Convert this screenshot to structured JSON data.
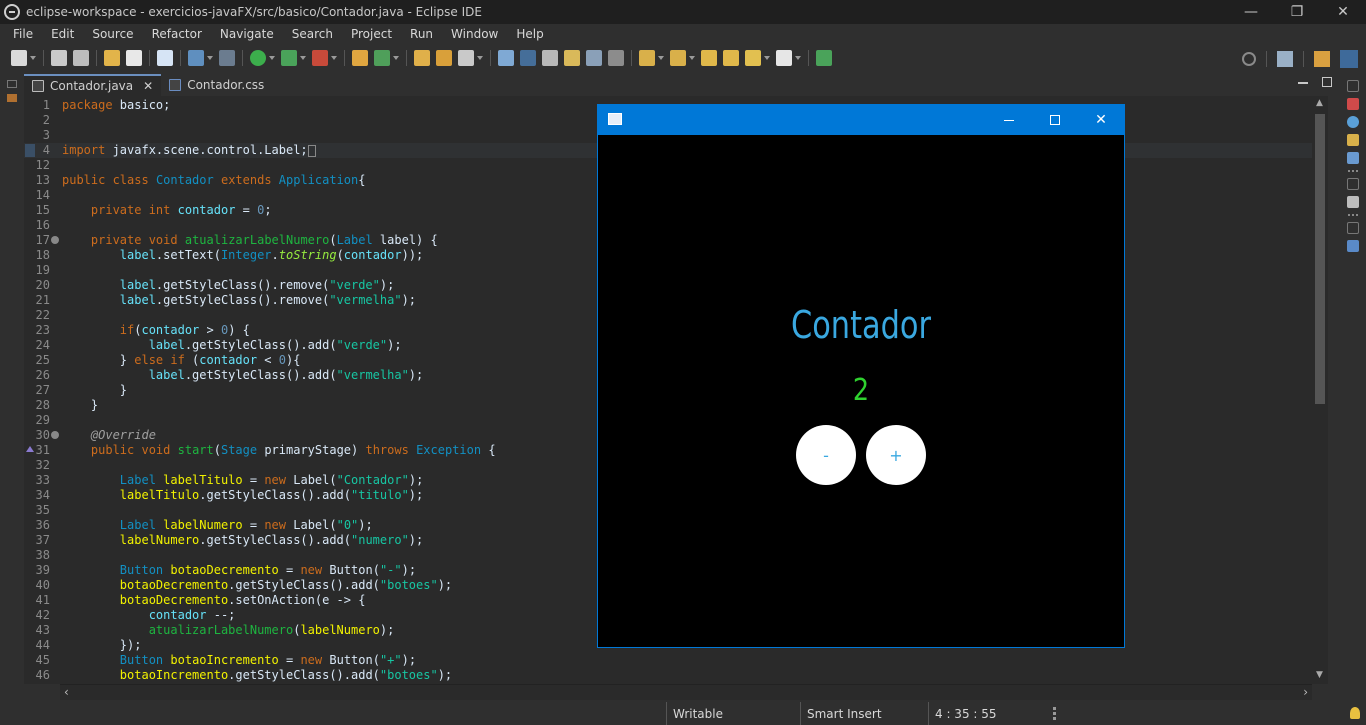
{
  "window": {
    "title": "eclipse-workspace - exercicios-javaFX/src/basico/Contador.java - Eclipse IDE",
    "minimize": "—",
    "restore": "❐",
    "close": "✕"
  },
  "menu": [
    "File",
    "Edit",
    "Source",
    "Refactor",
    "Navigate",
    "Search",
    "Project",
    "Run",
    "Window",
    "Help"
  ],
  "tabs": [
    {
      "label": "Contador.java",
      "close": "✕",
      "active": true
    },
    {
      "label": "Contador.css",
      "active": false
    }
  ],
  "code": {
    "l1_num": "1",
    "l1_kw": "package",
    "l1_txt": " basico;",
    "l2_num": "2",
    "l3_num": "3",
    "l4_num": "4",
    "l4_kw": "import",
    "l4_txt": " javafx.scene.control.Label;",
    "l12_num": "12",
    "l13_num": "13",
    "l13_kw1": "public class",
    "l13_cls": "Contador",
    "l13_kw2": "extends",
    "l13_sup": "Application",
    "l13_end": "{",
    "l14_num": "14",
    "l15_num": "15",
    "l15_kw": "private int",
    "l15_fld": "contador",
    "l15_eq": " = ",
    "l15_val": "0",
    "l15_end": ";",
    "l16_num": "16",
    "l17_num": "17",
    "l17_kw": "private void",
    "l17_m": "atualizarLabelNumero",
    "l17_p1": "(",
    "l17_ty": "Label",
    "l17_p2": " label) {",
    "l18_num": "18",
    "l18_a": "label",
    "l18_b": ".setText(",
    "l18_ty": "Integer",
    "l18_c": ".",
    "l18_it": "toString",
    "l18_d": "(",
    "l18_fld": "contador",
    "l18_e": "));",
    "l19_num": "19",
    "l20_num": "20",
    "l20_a": "label",
    "l20_b": ".getStyleClass().remove(",
    "l20_s": "\"verde\"",
    "l20_e": ");",
    "l21_num": "21",
    "l21_a": "label",
    "l21_b": ".getStyleClass().remove(",
    "l21_s": "\"vermelha\"",
    "l21_e": ");",
    "l22_num": "22",
    "l23_num": "23",
    "l23_kw": "if",
    "l23_a": "(",
    "l23_fld": "contador",
    "l23_b": " > ",
    "l23_n": "0",
    "l23_c": ") {",
    "l24_num": "24",
    "l24_a": "label",
    "l24_b": ".getStyleClass().add(",
    "l24_s": "\"verde\"",
    "l24_e": ");",
    "l25_num": "25",
    "l25_a": "} ",
    "l25_kw": "else if",
    "l25_b": " (",
    "l25_fld": "contador",
    "l25_c": " < ",
    "l25_n": "0",
    "l25_d": "){",
    "l26_num": "26",
    "l26_a": "label",
    "l26_b": ".getStyleClass().add(",
    "l26_s": "\"vermelha\"",
    "l26_e": ");",
    "l27_num": "27",
    "l27_a": "}",
    "l28_num": "28",
    "l28_a": "}",
    "l29_num": "29",
    "l30_num": "30",
    "l30_ann": "@Override",
    "l31_num": "31",
    "l31_kw": "public void",
    "l31_m": "start",
    "l31_a": "(",
    "l31_ty": "Stage",
    "l31_b": " primaryStage) ",
    "l31_kw2": "throws",
    "l31_ty2": "Exception",
    "l31_c": " {",
    "l32_num": "32",
    "l33_num": "33",
    "l33_ty": "Label",
    "l33_v": "labelTitulo",
    "l33_a": " = ",
    "l33_kw": "new",
    "l33_b": " Label(",
    "l33_s": "\"Contador\"",
    "l33_e": ");",
    "l34_num": "34",
    "l34_v": "labelTitulo",
    "l34_a": ".getStyleClass().add(",
    "l34_s": "\"titulo\"",
    "l34_e": ");",
    "l35_num": "35",
    "l36_num": "36",
    "l36_ty": "Label",
    "l36_v": "labelNumero",
    "l36_a": " = ",
    "l36_kw": "new",
    "l36_b": " Label(",
    "l36_s": "\"0\"",
    "l36_e": ");",
    "l37_num": "37",
    "l37_v": "labelNumero",
    "l37_a": ".getStyleClass().add(",
    "l37_s": "\"numero\"",
    "l37_e": ");",
    "l38_num": "38",
    "l39_num": "39",
    "l39_ty": "Button",
    "l39_v": "botaoDecremento",
    "l39_a": " = ",
    "l39_kw": "new",
    "l39_b": " Button(",
    "l39_s": "\"-\"",
    "l39_e": ");",
    "l40_num": "40",
    "l40_v": "botaoDecremento",
    "l40_a": ".getStyleClass().add(",
    "l40_s": "\"botoes\"",
    "l40_e": ");",
    "l41_num": "41",
    "l41_v": "botaoDecremento",
    "l41_a": ".setOnAction(e -> {",
    "l42_num": "42",
    "l42_fld": "contador",
    "l42_a": " --;",
    "l43_num": "43",
    "l43_m": "atualizarLabelNumero",
    "l43_a": "(",
    "l43_v": "labelNumero",
    "l43_b": ");",
    "l44_num": "44",
    "l44_a": "});",
    "l45_num": "45",
    "l45_ty": "Button",
    "l45_v": "botaoIncremento",
    "l45_a": " = ",
    "l45_kw": "new",
    "l45_b": " Button(",
    "l45_s": "\"+\"",
    "l45_e": ");",
    "l46_num": "46",
    "l46_v": "botaoIncremento",
    "l46_a": ".getStyleClass().add(",
    "l46_s": "\"botoes\"",
    "l46_e": ");"
  },
  "status": {
    "writable": "Writable",
    "insert_mode": "Smart Insert",
    "position": "4 : 35 : 55"
  },
  "app_window": {
    "minimize": "",
    "maximize": "",
    "close": "✕",
    "title_label": "Contador",
    "number": "2",
    "decrement_label": "-",
    "increment_label": "+"
  },
  "colors": {
    "fx_accent": "#0078d7",
    "title_blue": "#3aa8e0",
    "number_green": "#2fd12f"
  }
}
